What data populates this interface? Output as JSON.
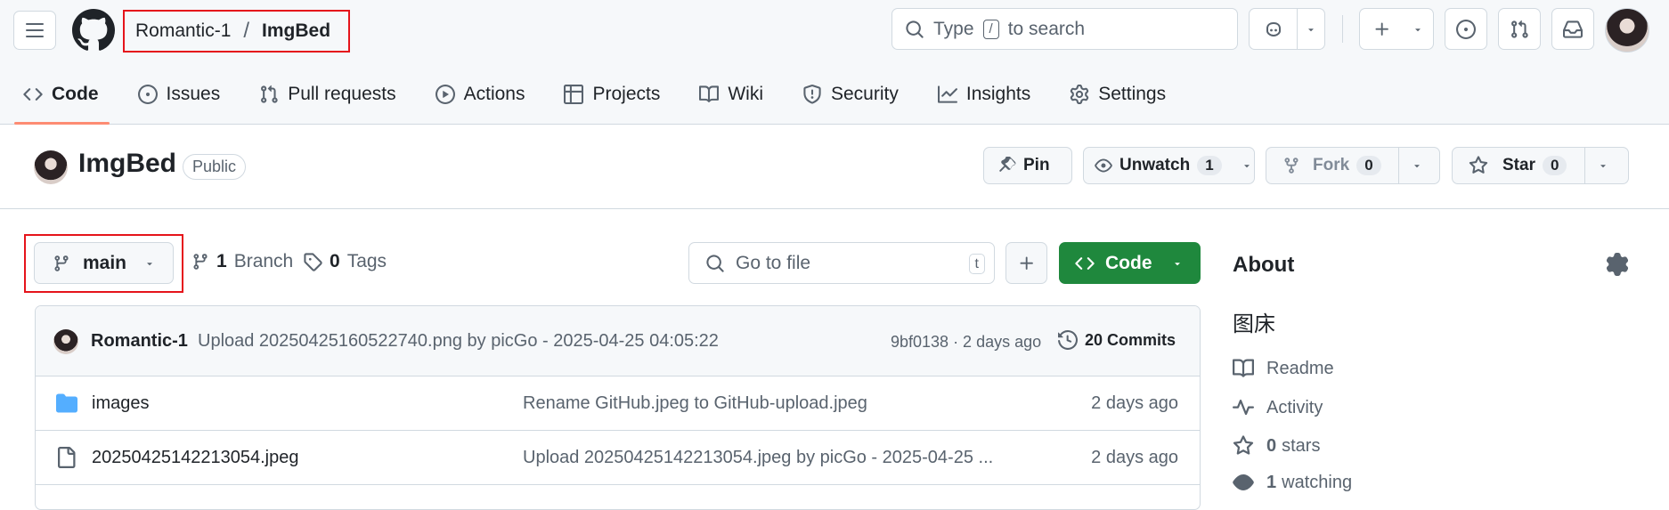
{
  "header": {
    "owner": "Romantic-1",
    "separator": "/",
    "repo": "ImgBed",
    "search_prefix": "Type",
    "search_key": "/",
    "search_suffix": "to search"
  },
  "tabs": [
    {
      "label": "Code",
      "icon": "code-icon",
      "active": true
    },
    {
      "label": "Issues",
      "icon": "issue-icon"
    },
    {
      "label": "Pull requests",
      "icon": "pull-request-icon"
    },
    {
      "label": "Actions",
      "icon": "play-icon"
    },
    {
      "label": "Projects",
      "icon": "table-icon"
    },
    {
      "label": "Wiki",
      "icon": "book-icon"
    },
    {
      "label": "Security",
      "icon": "shield-icon"
    },
    {
      "label": "Insights",
      "icon": "graph-icon"
    },
    {
      "label": "Settings",
      "icon": "gear-icon"
    }
  ],
  "repo_header": {
    "name": "ImgBed",
    "visibility": "Public",
    "pin_label": "Pin",
    "unwatch_label": "Unwatch",
    "watch_count": "1",
    "fork_label": "Fork",
    "fork_count": "0",
    "star_label": "Star",
    "star_count": "0"
  },
  "branch_bar": {
    "branch": "main",
    "branches_count": "1",
    "branches_label": "Branch",
    "tags_count": "0",
    "tags_label": "Tags",
    "goto_placeholder": "Go to file",
    "goto_key": "t",
    "code_label": "Code"
  },
  "latest_commit": {
    "author": "Romantic-1",
    "message": "Upload 20250425160522740.png by picGo - 2025-04-25 04:05:22",
    "hash_age": "9bf0138 · 2 days ago",
    "commits_label": "20 Commits"
  },
  "files": [
    {
      "name": "images",
      "type": "folder",
      "message": "Rename GitHub.jpeg to GitHub-upload.jpeg",
      "age": "2 days ago"
    },
    {
      "name": "20250425142213054.jpeg",
      "type": "file",
      "message": "Upload 20250425142213054.jpeg by picGo - 2025-04-25 ...",
      "age": "2 days ago"
    }
  ],
  "about": {
    "title": "About",
    "description": "图床",
    "readme": "Readme",
    "activity": "Activity",
    "stars_count": "0",
    "stars_label": "stars",
    "watching_count": "1",
    "watching_label": "watching"
  },
  "colors": {
    "accent_underline": "#fd8c73",
    "code_button": "#1f883d",
    "highlight_box": "#e5141b",
    "folder": "#54aeff"
  }
}
